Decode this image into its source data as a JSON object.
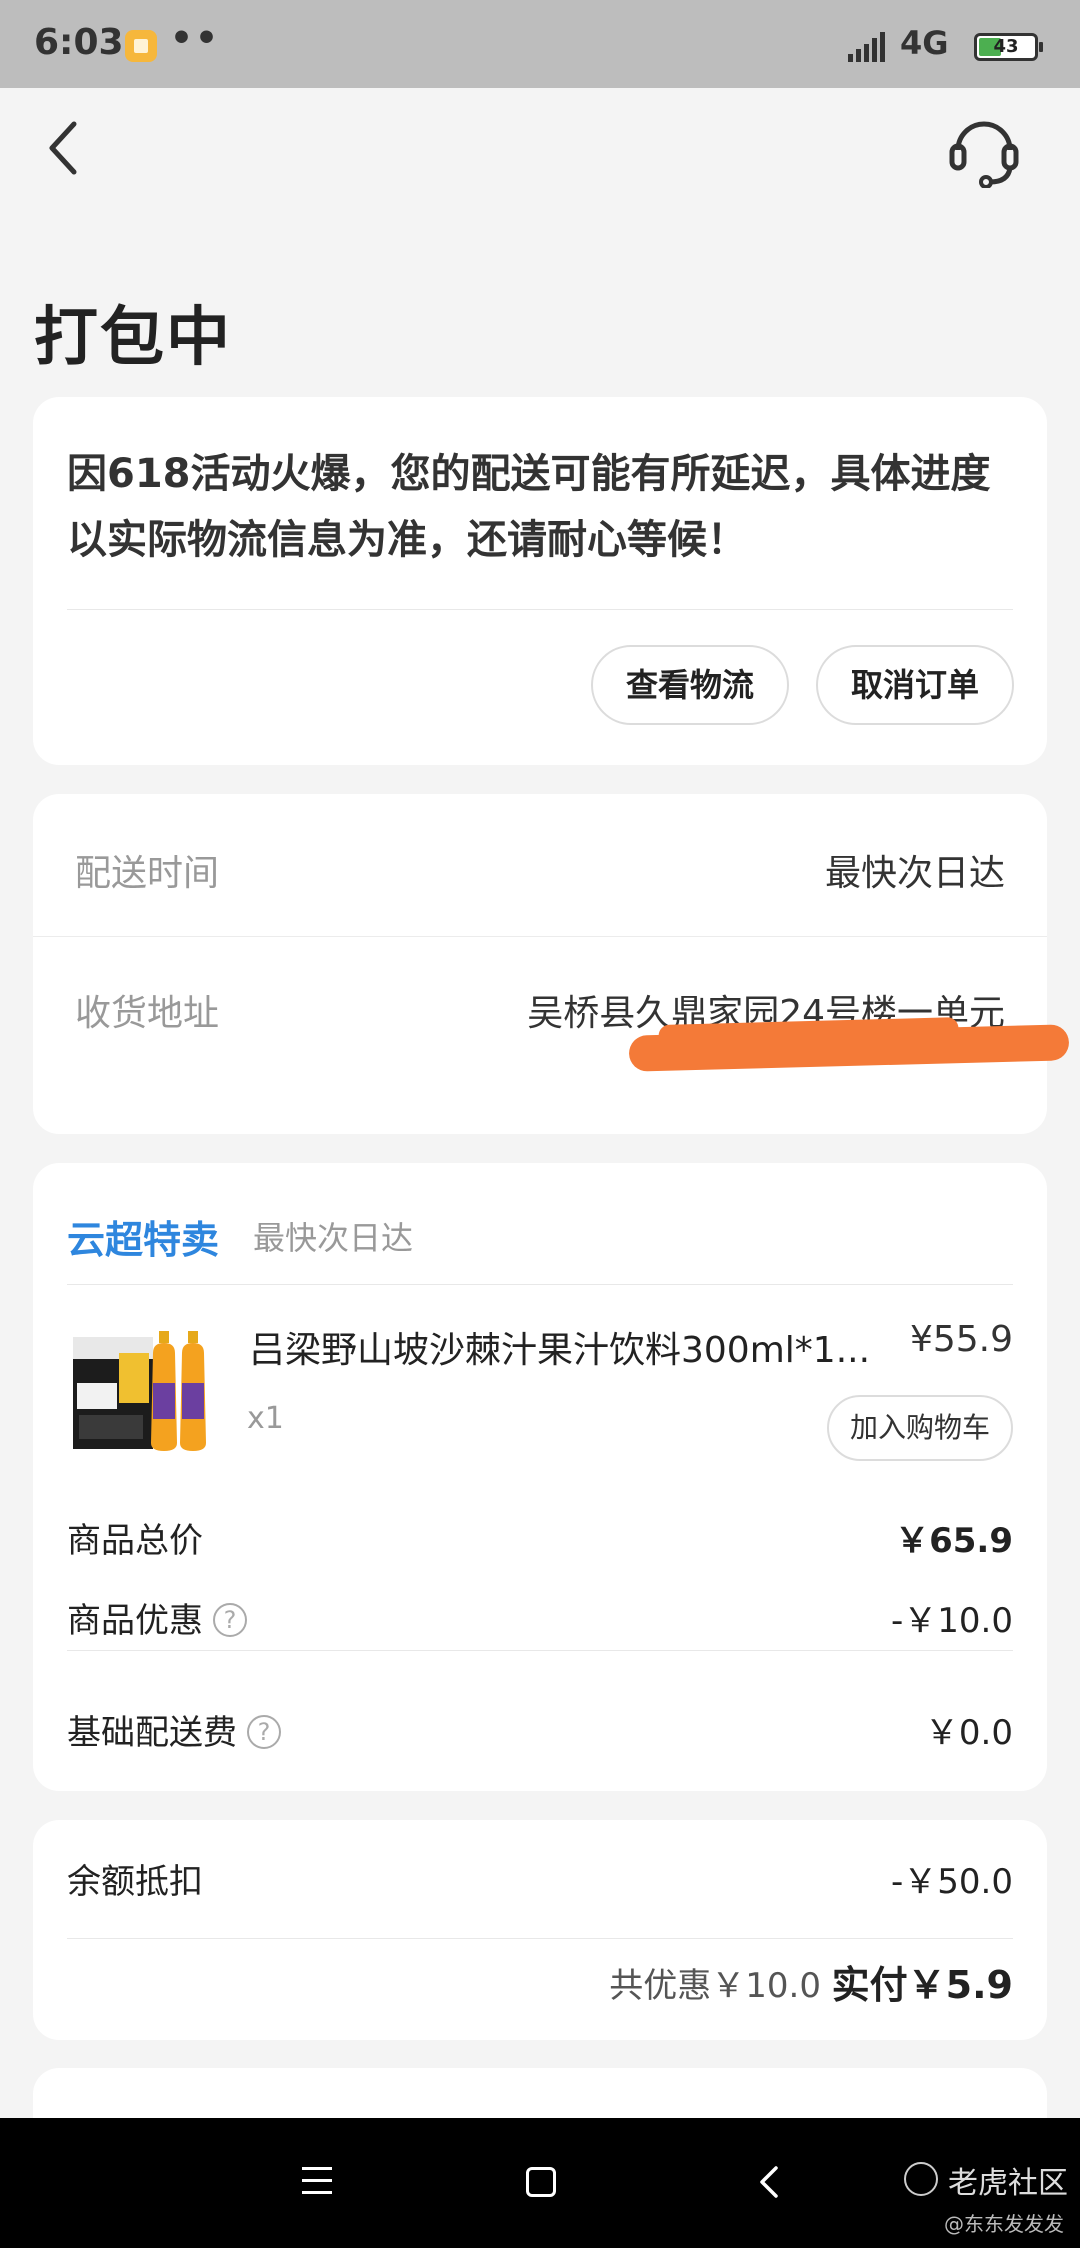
{
  "status_bar": {
    "time": "6:03",
    "dots": "••",
    "network": "4G",
    "battery": "43"
  },
  "header": {
    "back_icon": "chevron-left-icon",
    "service_icon": "headset-icon",
    "title": "打包中"
  },
  "notice": {
    "text": "因618活动火爆，您的配送可能有所延迟，具体进度以实际物流信息为准，还请耐心等候！",
    "buttons": {
      "logistics": "查看物流",
      "cancel": "取消订单"
    }
  },
  "delivery": {
    "time_label": "配送时间",
    "time_value": "最快次日达",
    "address_label": "收货地址",
    "address_value": "吴桥县久鼎家园24号楼一单元"
  },
  "order": {
    "store": "云超特卖",
    "store_tag": "最快次日达",
    "product": {
      "name": "吕梁野山坡沙棘汁果汁饮料300ml*1...",
      "price": "¥55.9",
      "qty": "x1",
      "add_cart": "加入购物车"
    },
    "fees": {
      "total_label": "商品总价",
      "total_value": "￥65.9",
      "discount_label": "商品优惠",
      "discount_value": "-￥10.0",
      "shipping_label": "基础配送费",
      "shipping_value": "￥0.0",
      "help_glyph": "?"
    }
  },
  "payment": {
    "balance_label": "余额抵扣",
    "balance_value": "-￥50.0",
    "savings": "共优惠￥10.0",
    "paid": "实付￥5.9"
  },
  "watermark": {
    "site": "老虎社区",
    "author": "@东东发发发"
  },
  "colors": {
    "accent": "#2e86de",
    "redaction": "#f47a38",
    "background": "#f4f4f4"
  }
}
